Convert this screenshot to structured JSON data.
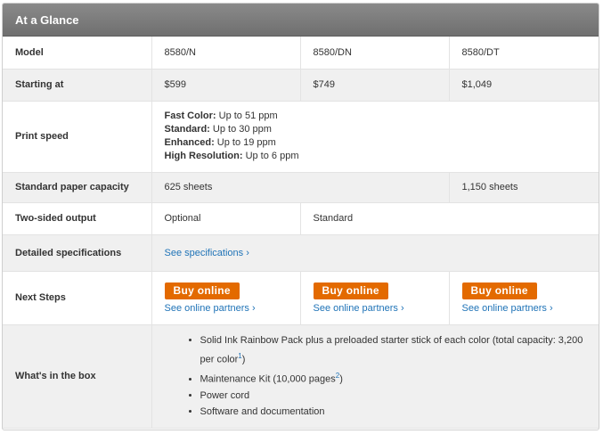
{
  "header": {
    "title": "At a Glance"
  },
  "rows": {
    "model": {
      "label": "Model",
      "values": [
        "8580/N",
        "8580/DN",
        "8580/DT"
      ]
    },
    "price": {
      "label": "Starting at",
      "values": [
        "$599",
        "$749",
        "$1,049"
      ]
    },
    "speed": {
      "label": "Print speed",
      "lines": [
        {
          "mode": "Fast Color:",
          "rate": "Up to 51 ppm"
        },
        {
          "mode": "Standard:",
          "rate": "Up to 30 ppm"
        },
        {
          "mode": "Enhanced:",
          "rate": "Up to 19 ppm"
        },
        {
          "mode": "High Resolution:",
          "rate": "Up to 6 ppm"
        }
      ]
    },
    "paper": {
      "label": "Standard paper capacity",
      "values": [
        "625 sheets",
        "1,150 sheets"
      ]
    },
    "duplex": {
      "label": "Two-sided output",
      "values": [
        "Optional",
        "Standard"
      ]
    },
    "specs": {
      "label": "Detailed specifications",
      "link": "See specifications ›"
    },
    "next": {
      "label": "Next Steps",
      "buy": "Buy online",
      "partners": "See online partners ›"
    },
    "box": {
      "label": "What's in the box",
      "item1": "Solid Ink Rainbow Pack plus a preloaded starter stick of each color (total capacity: 3,200 per color",
      "item1_fn": "1",
      "item1_end": ")",
      "item2": "Maintenance Kit (10,000 pages",
      "item2_fn": "2",
      "item2_end": ")",
      "item3": "Power cord",
      "item4": "Software and documentation"
    }
  },
  "colors": {
    "buy": "#e36a00",
    "link": "#1f73b7",
    "header": "#7c7c7c"
  }
}
